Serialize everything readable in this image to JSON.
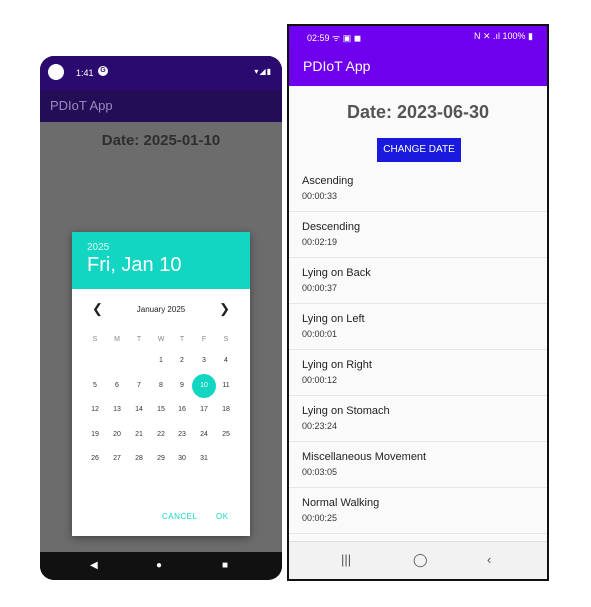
{
  "left_phone": {
    "status": {
      "time": "1:41",
      "g_icon": "G",
      "signal_icons": "▾◢▮"
    },
    "app_title": "PDIoT App",
    "date_label": "Date: 2025-01-10",
    "dialog": {
      "year": "2025",
      "date_header": "Fri, Jan 10",
      "month_label": "January 2025",
      "prev_icon": "chevron-left-icon",
      "next_icon": "chevron-right-icon",
      "weekdays": [
        "S",
        "M",
        "T",
        "W",
        "T",
        "F",
        "S"
      ],
      "weeks": [
        [
          "",
          "",
          "",
          "1",
          "2",
          "3",
          "4"
        ],
        [
          "5",
          "6",
          "7",
          "8",
          "9",
          "10",
          "11"
        ],
        [
          "12",
          "13",
          "14",
          "15",
          "16",
          "17",
          "18"
        ],
        [
          "19",
          "20",
          "21",
          "22",
          "23",
          "24",
          "25"
        ],
        [
          "26",
          "27",
          "28",
          "29",
          "30",
          "31",
          ""
        ]
      ],
      "selected_day": "10",
      "cancel_label": "CANCEL",
      "ok_label": "OK"
    },
    "nav": {
      "back": "◀",
      "home": "●",
      "recents": "■"
    }
  },
  "right_phone": {
    "status": {
      "time": "02:59 ᯤ ▣ ◼",
      "right": "N ✕ .ıl 100% ▮"
    },
    "app_title": "PDIoT App",
    "date_label": "Date: 2023-06-30",
    "change_date_label": "CHANGE DATE",
    "activities": [
      {
        "name": "Ascending",
        "duration": "00:00:33"
      },
      {
        "name": "Descending",
        "duration": "00:02:19"
      },
      {
        "name": "Lying on Back",
        "duration": "00:00:37"
      },
      {
        "name": "Lying on Left",
        "duration": "00:00:01"
      },
      {
        "name": "Lying on Right",
        "duration": "00:00:12"
      },
      {
        "name": "Lying on Stomach",
        "duration": "00:23:24"
      },
      {
        "name": "Miscellaneous Movement",
        "duration": "00:03:05"
      },
      {
        "name": "Normal Walking",
        "duration": "00:00:25"
      }
    ],
    "nav": {
      "recents": "|||",
      "home": "◯",
      "back": "‹"
    }
  },
  "colors": {
    "teal_accent": "#12d6c2",
    "purple_appbar": "#6f00ee",
    "button_blue": "#1a1adf"
  }
}
